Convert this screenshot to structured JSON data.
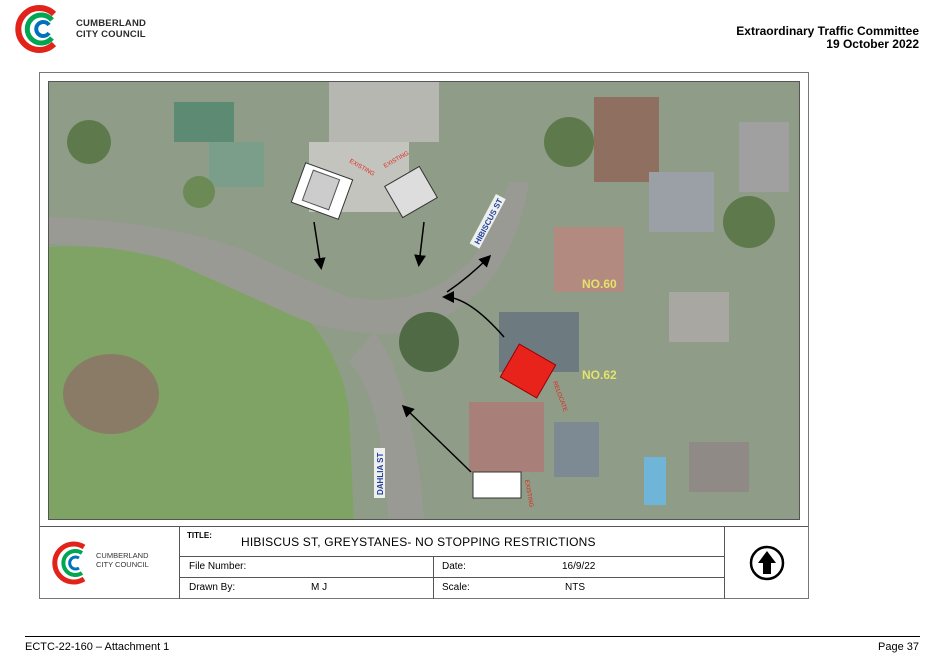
{
  "header": {
    "org_name_line1": "CUMBERLAND",
    "org_name_line2": "CITY COUNCIL",
    "committee": "Extraordinary Traffic Committee",
    "date": "19 October 2022"
  },
  "map": {
    "street_labels": [
      "HIBISCUS ST",
      "DAHLIA ST"
    ],
    "house_labels": [
      "NO.60",
      "NO.62"
    ],
    "sign_labels": [
      "EXISTING",
      "EXISTING",
      "RELOCATE",
      "EXISTING"
    ]
  },
  "title_block": {
    "logo_line1": "CUMBERLAND",
    "logo_line2": "CITY COUNCIL",
    "title_label": "TITLE:",
    "title_value": "HIBISCUS ST, GREYSTANES- NO STOPPING RESTRICTIONS",
    "file_number_label": "File Number:",
    "file_number_value": "",
    "date_label": "Date:",
    "date_value": "16/9/22",
    "drawn_by_label": "Drawn By:",
    "drawn_by_value": "M J",
    "scale_label": "Scale:",
    "scale_value": "NTS"
  },
  "footer": {
    "attachment": "ECTC-22-160 – Attachment 1",
    "page": "Page 37"
  },
  "colors": {
    "logo_red": "#e2231a",
    "logo_green": "#00a651",
    "logo_blue": "#0072bc",
    "relocate_red": "#e8231c",
    "street_label_blue": "#1f3fa0"
  }
}
